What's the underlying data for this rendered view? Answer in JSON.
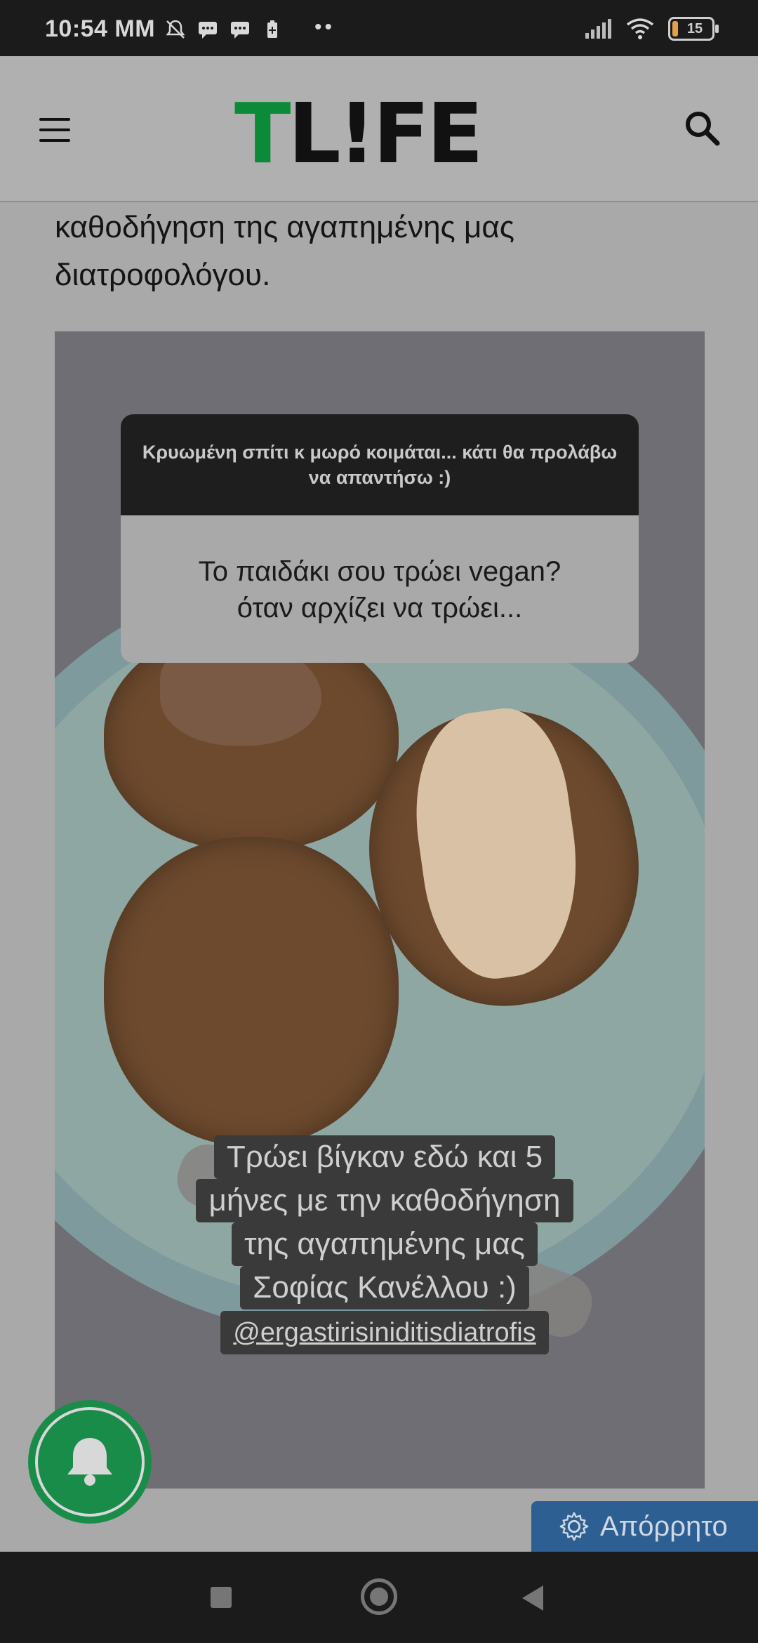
{
  "status_bar": {
    "time": "10:54 MM",
    "battery_level": "15"
  },
  "header": {
    "logo_t": "T",
    "logo_rest": "L!FE",
    "menu_icon": "hamburger-icon",
    "search_icon": "search-icon"
  },
  "article": {
    "text_line_1": "καθοδήγηση της αγαπημένης μας",
    "text_line_2": "διατροφολόγου."
  },
  "story": {
    "question_header": "Κρυωμένη σπίτι κ μωρό κοιμάται... κάτι θα προλάβω να απαντήσω :)",
    "question_text_line_1": "Το παιδάκι σου τρώει vegan?",
    "question_text_line_2": "όταν αρχίζει να τρώει...",
    "caption_line_1": "Τρώει βίγκαν εδώ και 5",
    "caption_line_2": "μήνες με την καθοδήγηση",
    "caption_line_3": "της αγαπημένης μας",
    "caption_line_4": "Σοφίας Κανέλλου :)",
    "caption_handle": "@ergastirisiniditisdiatrofis"
  },
  "privacy_button": {
    "label": "Απόρρητο",
    "icon": "gear-icon"
  },
  "notification_button": {
    "icon": "bell-icon"
  },
  "colors": {
    "brand_green": "#0b8a3a",
    "privacy_blue": "#2e5f92"
  }
}
